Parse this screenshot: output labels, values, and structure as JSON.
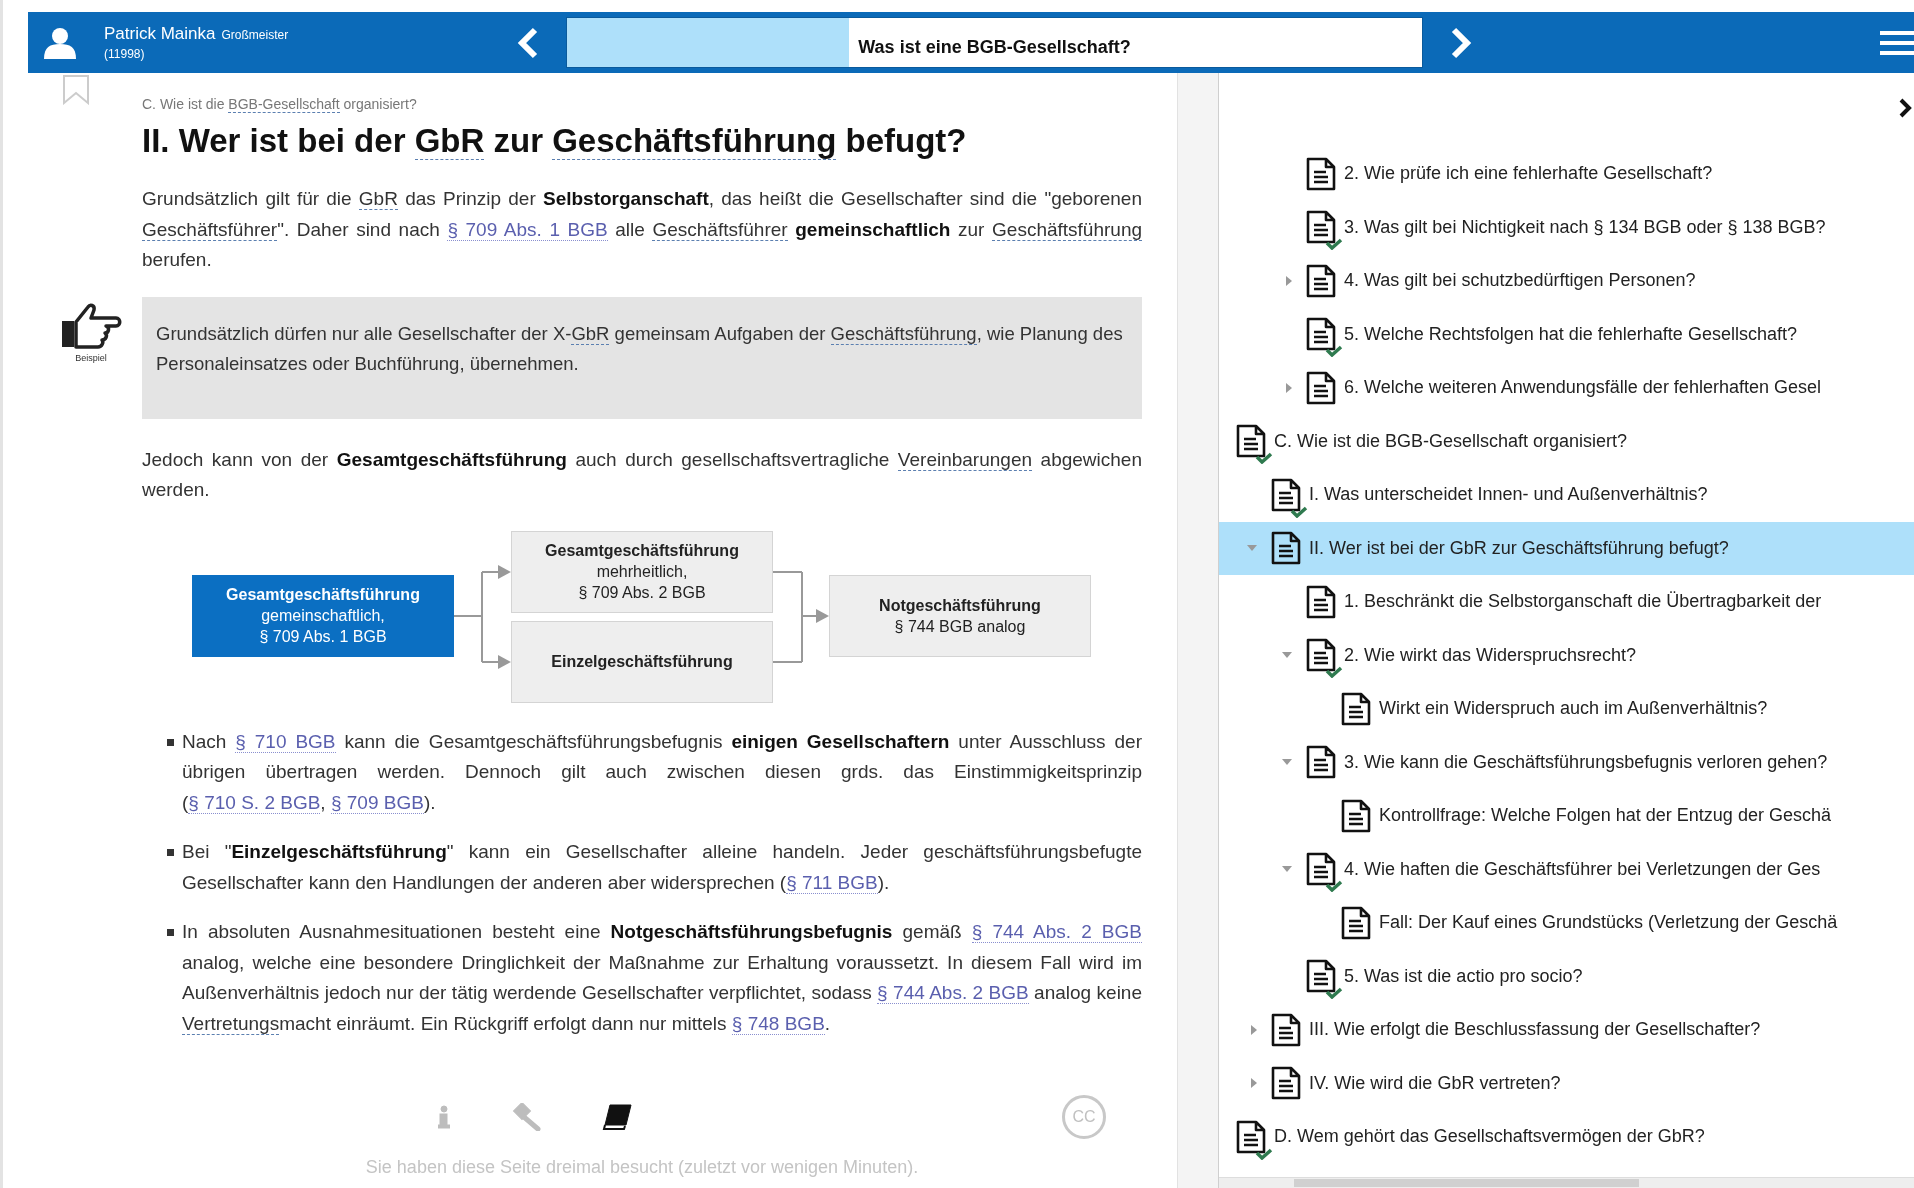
{
  "header": {
    "user_name": "Patrick Mainka",
    "user_rank": "Großmeister",
    "user_points": "(11998)",
    "chapter": {
      "title": "Was ist eine BGB-Gesellschaft?",
      "level": 0.33
    }
  },
  "article": {
    "breadcrumb": [
      {
        "text": "C. Wie ist die ",
        "kind": "plain"
      },
      {
        "text": "BGB-Gesellschaft",
        "kind": "term"
      },
      {
        "text": " organisiert?",
        "kind": "plain"
      }
    ],
    "heading": [
      {
        "text": "II. Wer ist bei der ",
        "kind": "plain"
      },
      {
        "text": "GbR",
        "kind": "term"
      },
      {
        "text": " zur ",
        "kind": "plain"
      },
      {
        "text": "Geschäftsführung",
        "kind": "term"
      },
      {
        "text": " befugt?",
        "kind": "plain"
      }
    ],
    "blocks": [
      {
        "kind": "paragraph",
        "segments": [
          {
            "text": "Grundsätzlich gilt für die ",
            "kind": "plain"
          },
          {
            "text": "GbR",
            "kind": "term"
          },
          {
            "text": " das Prinzip der ",
            "kind": "plain"
          },
          {
            "text": "Selbstorganschaft",
            "kind": "bold"
          },
          {
            "text": ", das heißt die Gesellschafter sind die \"geborenen ",
            "kind": "plain"
          },
          {
            "text": "Geschäftsführer",
            "kind": "term"
          },
          {
            "text": "\". Daher sind nach ",
            "kind": "plain"
          },
          {
            "text": "§ 709 Abs. 1 BGB",
            "kind": "link"
          },
          {
            "text": " alle ",
            "kind": "plain"
          },
          {
            "text": "Geschäftsführer",
            "kind": "term"
          },
          {
            "text": " gemeinschaftlich",
            "kind": "bold"
          },
          {
            "text": " zur ",
            "kind": "plain"
          },
          {
            "text": "Geschäftsführung",
            "kind": "term"
          },
          {
            "text": " berufen.",
            "kind": "plain"
          }
        ]
      },
      {
        "kind": "example",
        "label": "Beispiel",
        "segments": [
          {
            "text": "Grundsätzlich dürfen nur alle Gesellschafter der X-",
            "kind": "plain"
          },
          {
            "text": "GbR",
            "kind": "term"
          },
          {
            "text": " gemeinsam Aufgaben der ",
            "kind": "plain"
          },
          {
            "text": "Geschäftsführung",
            "kind": "term"
          },
          {
            "text": ", wie Planung des Personaleinsatzes oder Buchführung, übernehmen.",
            "kind": "plain"
          }
        ]
      },
      {
        "kind": "paragraph",
        "segments": [
          {
            "text": "Jedoch kann von der ",
            "kind": "plain"
          },
          {
            "text": "Gesamtgeschäftsführung",
            "kind": "bold"
          },
          {
            "text": " auch durch gesellschaftsvertragliche ",
            "kind": "plain"
          },
          {
            "text": "Vereinbarungen",
            "kind": "term"
          },
          {
            "text": " abgewichen werden.",
            "kind": "plain"
          }
        ]
      },
      {
        "kind": "diagram",
        "nodes": [
          {
            "title": "Gesamtgeschäftsführung",
            "lines": [
              "gemeinschaftlich,",
              "§ 709 Abs. 1 BGB"
            ],
            "highlighted": true
          },
          {
            "title": "Gesamtgeschäftsführung",
            "lines": [
              "mehrheitlich,",
              "§ 709 Abs. 2 BGB"
            ],
            "highlighted": false
          },
          {
            "title": "Einzelgeschäftsführung",
            "highlighted": false
          },
          {
            "title": "Notgeschäftsführung",
            "lines": [
              "§ 744 BGB analog"
            ],
            "highlighted": false
          }
        ]
      },
      {
        "kind": "bullets",
        "items": [
          [
            {
              "text": "Nach ",
              "kind": "plain"
            },
            {
              "text": "§ 710 BGB",
              "kind": "link"
            },
            {
              "text": " kann die Gesamtgeschäftsführungsbefugnis ",
              "kind": "plain"
            },
            {
              "text": "einigen Gesellschaftern",
              "kind": "bold"
            },
            {
              "text": " unter Ausschluss der übrigen übertragen werden. Dennoch gilt auch zwischen diesen grds. das Einstimmigkeitsprinzip (",
              "kind": "plain"
            },
            {
              "text": "§ 710 S. 2 BGB",
              "kind": "link"
            },
            {
              "text": ", ",
              "kind": "plain"
            },
            {
              "text": "§ 709 BGB",
              "kind": "link"
            },
            {
              "text": ").",
              "kind": "plain"
            }
          ],
          [
            {
              "text": "Bei \"",
              "kind": "plain"
            },
            {
              "text": "Einzelgeschäftsführung",
              "kind": "bold"
            },
            {
              "text": "\" kann ein Gesellschafter alleine handeln. Jeder geschäftsführungsbefugte Gesellschafter kann den Handlungen der anderen aber widersprechen (",
              "kind": "plain"
            },
            {
              "text": "§ 711 BGB",
              "kind": "link"
            },
            {
              "text": ").",
              "kind": "plain"
            }
          ],
          [
            {
              "text": "In absoluten Ausnahmesituationen besteht eine ",
              "kind": "plain"
            },
            {
              "text": "Notgeschäftsführungsbefugnis",
              "kind": "bold"
            },
            {
              "text": " gemäß ",
              "kind": "plain"
            },
            {
              "text": "§ 744 Abs. 2 BGB",
              "kind": "link"
            },
            {
              "text": " analog, welche eine besondere Dringlichkeit der Maßnahme zur Erhaltung voraussetzt. In diesem Fall wird im Außenverhältnis jedoch nur der tätig werdende Gesellschafter verpflichtet, sodass ",
              "kind": "plain"
            },
            {
              "text": "§ 744 Abs. 2 BGB",
              "kind": "link"
            },
            {
              "text": " analog keine ",
              "kind": "plain"
            },
            {
              "text": "Vertretungs",
              "kind": "term"
            },
            {
              "text": "macht einräumt. Ein Rückgriff erfolgt dann nur mittels ",
              "kind": "plain"
            },
            {
              "text": "§ 748 BGB",
              "kind": "link"
            },
            {
              "text": ".",
              "kind": "plain"
            }
          ]
        ]
      }
    ],
    "tools": [
      {
        "kind": "info",
        "selected": false
      },
      {
        "kind": "gavel",
        "selected": false
      },
      {
        "kind": "book",
        "selected": true
      }
    ],
    "license_badge": "CC",
    "visit_note": "Sie haben diese Seite dreimal besucht (zuletzt vor wenigen Minuten)."
  },
  "outline": [
    {
      "children": [
        {
          "children": [
            {
              "label": "2. Wie prüfe ich eine fehlerhafte Gesellschaft?",
              "done": false,
              "selected": false
            },
            {
              "label": "3. Was gilt bei Nichtigkeit nach § 134 BGB oder § 138 BGB?",
              "done": true,
              "selected": false
            },
            {
              "label": "4. Was gilt bei schutzbedürftigen Personen?",
              "done": false,
              "expanded": false,
              "selected": false
            },
            {
              "label": "5. Welche Rechtsfolgen hat die fehlerhafte Gesellschaft?",
              "done": true,
              "selected": false
            },
            {
              "label": "6. Welche weiteren Anwendungsfälle der fehlerhaften Gesel",
              "done": false,
              "expanded": false,
              "selected": false
            }
          ]
        }
      ]
    },
    {
      "label": "C. Wie ist die BGB-Gesellschaft organisiert?",
      "done": true,
      "selected": false,
      "children": [
        {
          "label": "I. Was unterscheidet Innen- und Außenverhältnis?",
          "done": true,
          "selected": false
        },
        {
          "label": "II. Wer ist bei der GbR zur Geschäftsführung befugt?",
          "done": false,
          "expanded": true,
          "selected": true,
          "children": [
            {
              "label": "1. Beschränkt die Selbstorganschaft die Übertragbarkeit der",
              "done": false,
              "selected": false
            },
            {
              "label": "2. Wie wirkt das Widerspruchsrecht?",
              "done": true,
              "expanded": true,
              "selected": false,
              "children": [
                {
                  "label": "Wirkt ein Widerspruch auch im Außenverhältnis?",
                  "done": false,
                  "selected": false
                }
              ]
            },
            {
              "label": "3. Wie kann die Geschäftsführungsbefugnis verloren gehen?",
              "done": false,
              "expanded": true,
              "selected": false,
              "children": [
                {
                  "label": "Kontrollfrage: Welche Folgen hat der Entzug der Geschä",
                  "done": false,
                  "selected": false
                }
              ]
            },
            {
              "label": "4. Wie haften die Geschäftsführer bei Verletzungen der Ges",
              "done": true,
              "expanded": true,
              "selected": false,
              "children": [
                {
                  "label": "Fall: Der Kauf eines Grundstücks (Verletzung der Geschä",
                  "done": false,
                  "selected": false
                }
              ]
            },
            {
              "label": "5. Was ist die actio pro socio?",
              "done": true,
              "selected": false
            }
          ]
        },
        {
          "label": "III. Wie erfolgt die Beschlussfassung der Gesellschafter?",
          "done": false,
          "expanded": false,
          "selected": false
        },
        {
          "label": "IV. Wie wird die GbR vertreten?",
          "done": false,
          "expanded": false,
          "selected": false
        }
      ]
    },
    {
      "label": "D. Wem gehört das Gesellschaftsvermögen der GbR?",
      "done": true,
      "selected": false
    }
  ]
}
